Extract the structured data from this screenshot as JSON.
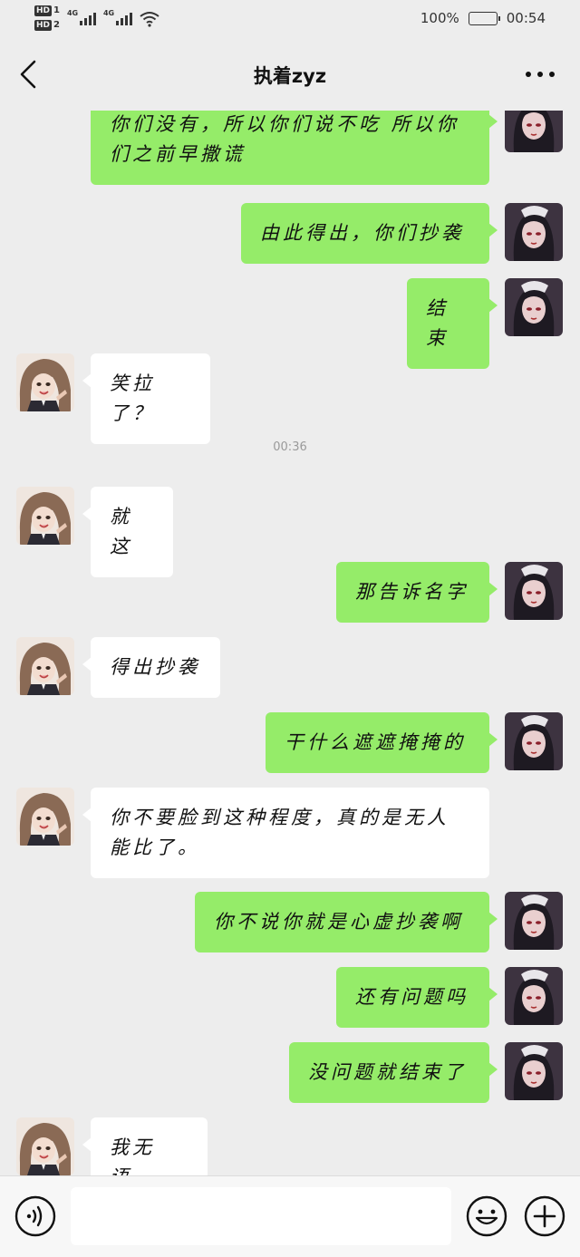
{
  "status_bar": {
    "sim1": "HD",
    "sim1_num": "1",
    "sim2": "HD",
    "sim2_num": "2",
    "net1": "4G",
    "net2": "4G",
    "battery_pct": "100%",
    "battery_level": 1.0,
    "time": "00:54"
  },
  "header": {
    "title": "执着zyz"
  },
  "chat": {
    "messages": [
      {
        "side": "me",
        "text": "你们没有，所以你们说不吃 所以你们之前早撒谎"
      },
      {
        "side": "me",
        "text": "由此得出，你们抄袭"
      },
      {
        "side": "me",
        "text": "结束"
      },
      {
        "side": "peer",
        "text": "笑拉了？"
      },
      {
        "side": "time",
        "text": "00:36"
      },
      {
        "side": "peer",
        "text": "就这"
      },
      {
        "side": "me",
        "text": "那告诉名字"
      },
      {
        "side": "peer",
        "text": "得出抄袭"
      },
      {
        "side": "me",
        "text": "干什么遮遮掩掩的"
      },
      {
        "side": "peer",
        "text": "你不要脸到这种程度，真的是无人能比了。"
      },
      {
        "side": "me",
        "text": "你不说你就是心虚抄袭啊"
      },
      {
        "side": "me",
        "text": "还有问题吗"
      },
      {
        "side": "me",
        "text": "没问题就结束了"
      },
      {
        "side": "peer",
        "text": "我无语，"
      }
    ]
  },
  "input": {
    "value": "",
    "placeholder": ""
  },
  "icons": {
    "back": "back-arrow-icon",
    "more": "more-dots-icon",
    "voice": "voice-icon",
    "emoji": "emoji-icon",
    "plus": "plus-icon",
    "wifi": "wifi-icon",
    "battery": "battery-icon"
  },
  "colors": {
    "background": "#ededed",
    "my_bubble": "#95ec69",
    "peer_bubble": "#ffffff",
    "input_bar": "#f7f7f7"
  }
}
